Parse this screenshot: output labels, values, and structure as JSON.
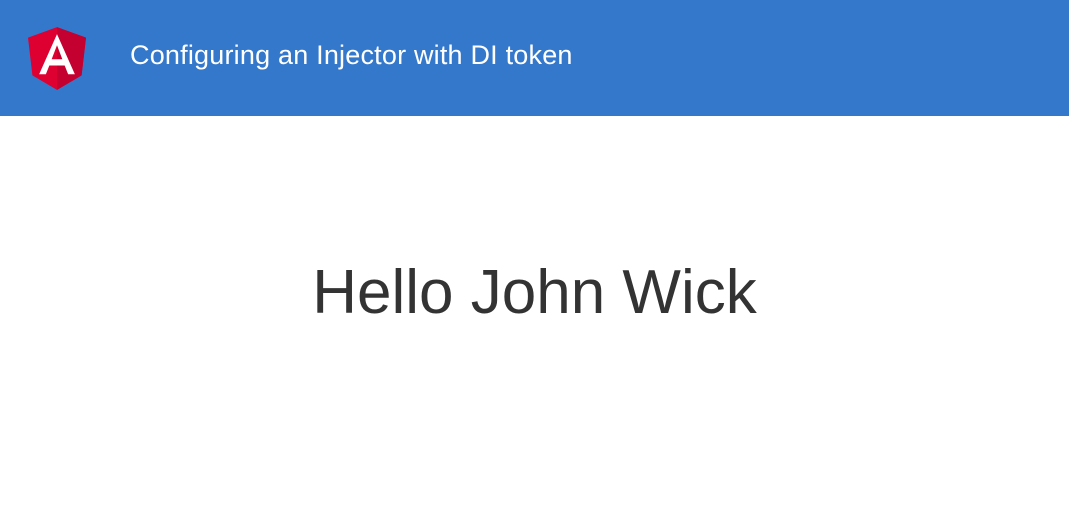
{
  "toolbar": {
    "logo_icon": "angular-logo-icon",
    "title": "Configuring an Injector with DI token",
    "background_color": "#3478cc"
  },
  "main": {
    "greeting": "Hello John Wick"
  }
}
